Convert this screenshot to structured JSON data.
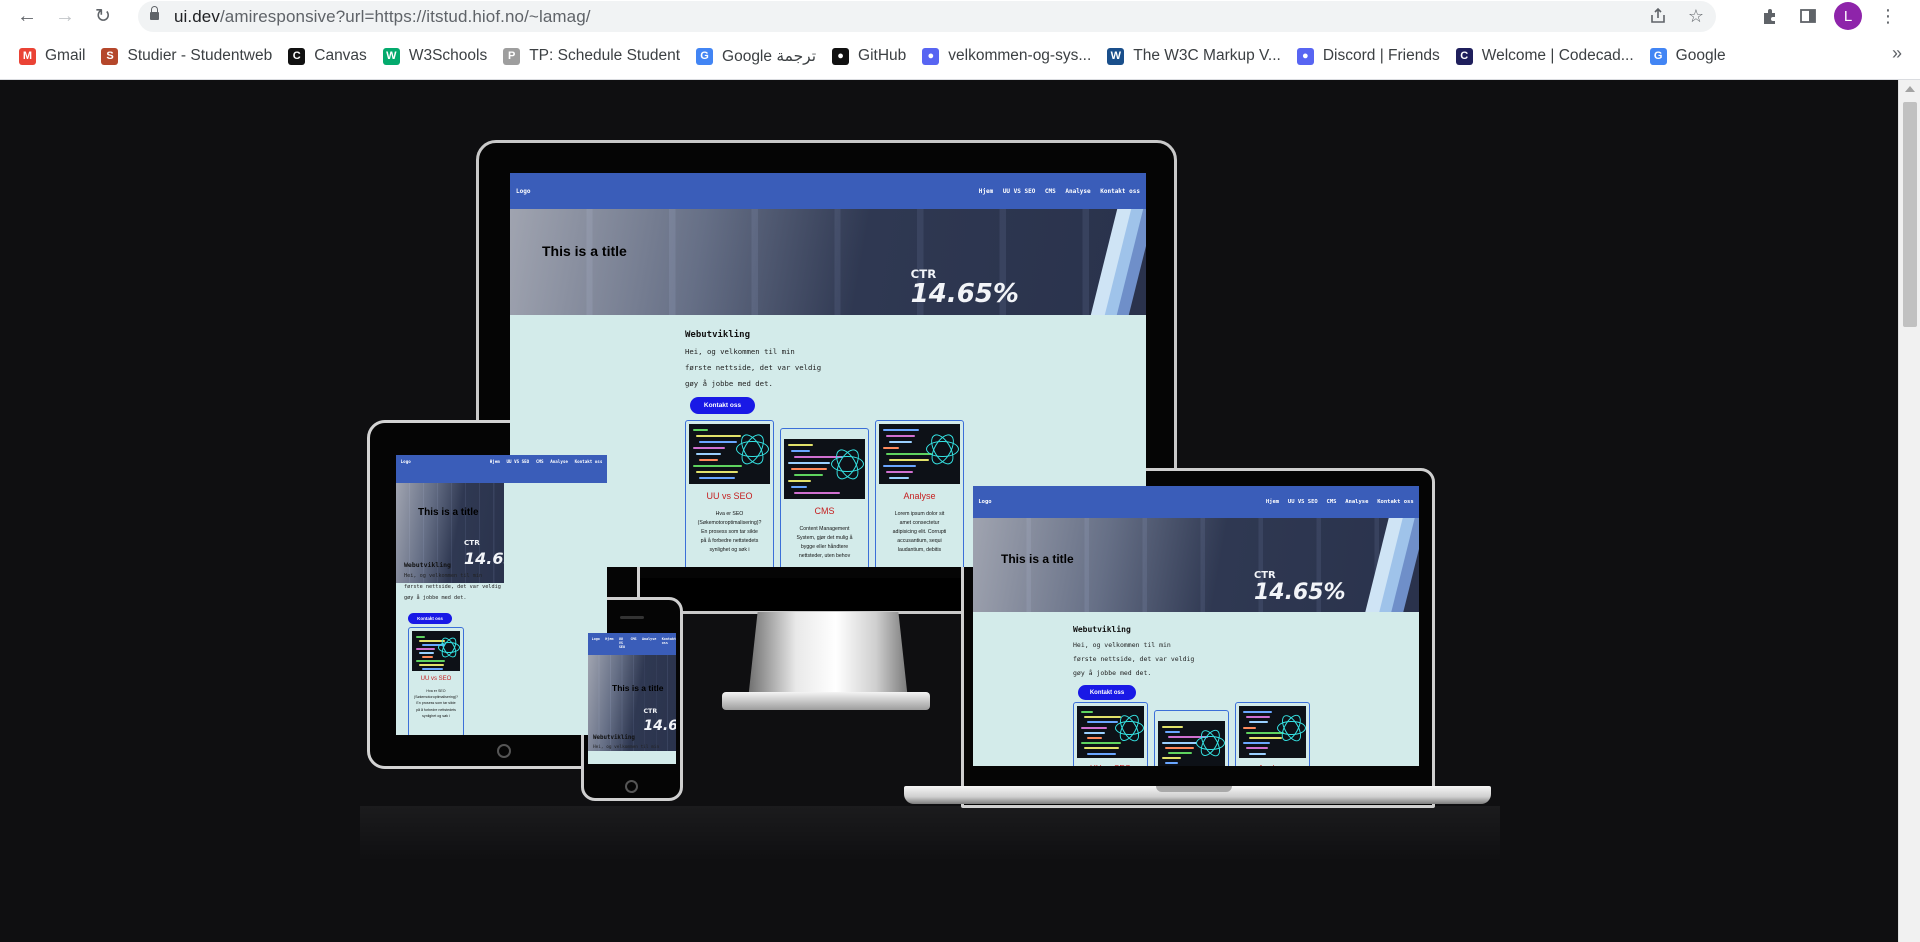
{
  "browser": {
    "url_host": "ui.dev",
    "url_path": "/amiresponsive?url=https://itstud.hiof.no/~lamag/",
    "avatar_letter": "L",
    "bookmarks": [
      {
        "label": "Gmail",
        "icon": "gmail-icon",
        "color": "#ea4335"
      },
      {
        "label": "Studier - Studentweb",
        "icon": "studentweb-icon",
        "color": "#b5472b"
      },
      {
        "label": "Canvas",
        "icon": "canvas-icon",
        "color": "#111111"
      },
      {
        "label": "W3Schools",
        "icon": "w3schools-icon",
        "color": "#04aa6d"
      },
      {
        "label": "TP: Schedule Student",
        "icon": "tp-icon",
        "color": "#9e9e9e"
      },
      {
        "label": "Google ترجمة",
        "icon": "google-translate-icon",
        "color": "#4285f4"
      },
      {
        "label": "GitHub",
        "icon": "github-icon",
        "color": "#111111"
      },
      {
        "label": "velkommen-og-sys...",
        "icon": "discord-icon",
        "color": "#5865f2"
      },
      {
        "label": "The W3C Markup V...",
        "icon": "w3c-icon",
        "color": "#1a4f8b"
      },
      {
        "label": "Discord | Friends",
        "icon": "discord-icon",
        "color": "#5865f2"
      },
      {
        "label": "Welcome | Codecad...",
        "icon": "codecademy-icon",
        "color": "#1f1f5c"
      },
      {
        "label": "Google",
        "icon": "google-icon",
        "color": "#4285f4"
      }
    ]
  },
  "site": {
    "logo": "Logo",
    "nav": [
      "Hjem",
      "UU VS SEO",
      "CMS",
      "Analyse",
      "Kontakt oss"
    ],
    "hero_title": "This is a title",
    "hero_image_text": "14.65%",
    "hero_image_label": "CTR",
    "heading": "Webutvikling",
    "intro_lines": [
      "Hei, og velkommen til min",
      "første nettside, det var veldig",
      "gøy å jobbe med det."
    ],
    "button": "Kontakt oss",
    "cards": [
      {
        "title": "UU vs SEO",
        "text": [
          "Hva er SEO",
          "(Søkemotoroptimalisering)?",
          "En prosess som tar sikte",
          "på å forbedre nettstedets",
          "synlighet og søk i"
        ]
      },
      {
        "title": "CMS",
        "text": [
          "Content Management",
          "System, gjør det mulig å",
          "bygge eller håndtere",
          "nettsteder, uten behov"
        ]
      },
      {
        "title": "Analyse",
        "text": [
          "Lorem ipsum dolor sit",
          "amet consectetur",
          "adipisicing elit. Corrupti",
          "accusantium, sequi",
          "laudantium, debitis"
        ]
      }
    ]
  },
  "colors": {
    "site_nav": "#3a5db9",
    "site_bg": "#d3ebea",
    "button": "#1919e6",
    "card_title": "#c51e1e",
    "page_bg": "#0f0f11"
  }
}
